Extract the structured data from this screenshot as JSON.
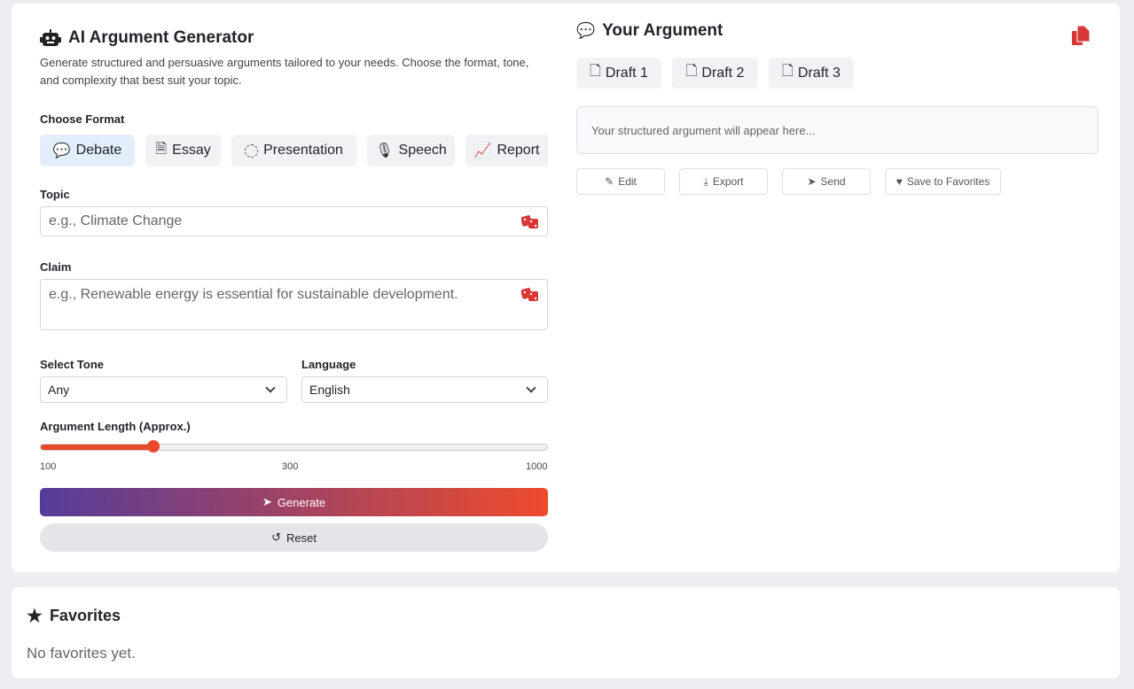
{
  "generator": {
    "title": "AI Argument Generator",
    "description": "Generate structured and persuasive arguments tailored to your needs. Choose the format, tone, and complexity that best suit your topic.",
    "format_label": "Choose Format",
    "formats": [
      {
        "label": "Debate",
        "icon": "comments-icon",
        "active": true
      },
      {
        "label": "Essay",
        "icon": "file-text-icon"
      },
      {
        "label": "Presentation",
        "icon": "circle-dashed-icon"
      },
      {
        "label": "Speech",
        "icon": "microphone-icon"
      },
      {
        "label": "Report",
        "icon": "chart-line-icon"
      }
    ],
    "topic_label": "Topic",
    "topic_placeholder": "e.g., Climate Change",
    "claim_label": "Claim",
    "claim_placeholder": "e.g., Renewable energy is essential for sustainable development.",
    "tone_label": "Select Tone",
    "tone_value": "Any",
    "language_label": "Language",
    "language_value": "English",
    "length_label": "Argument Length (Approx.)",
    "length_value": 300,
    "length_min": "100",
    "length_mid": "300",
    "length_max": "1000",
    "generate_label": "Generate",
    "reset_label": "Reset"
  },
  "output": {
    "title": "Your Argument",
    "drafts": [
      "Draft 1",
      "Draft 2",
      "Draft 3"
    ],
    "placeholder": "Your structured argument will appear here...",
    "actions": [
      "Edit",
      "Export",
      "Send",
      "Save to Favorites"
    ]
  },
  "favorites": {
    "title": "Favorites",
    "empty": "No favorites yet."
  },
  "colors": {
    "accent": "#d93636",
    "gradient_start": "#553c9a",
    "gradient_end": "#ee4b2b",
    "slider": "#e8492a"
  }
}
